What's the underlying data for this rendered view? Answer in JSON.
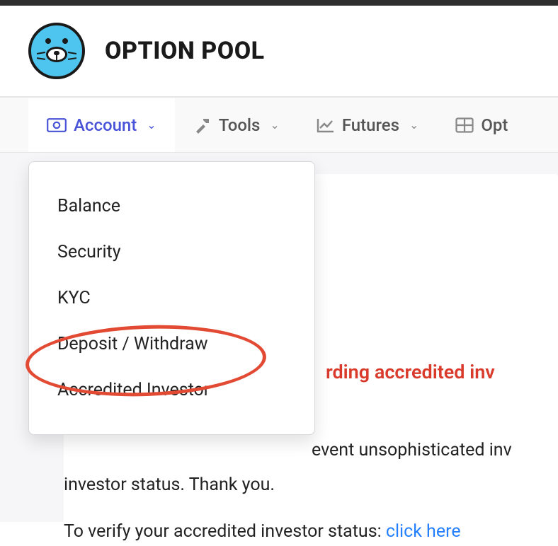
{
  "brand": {
    "name": "OPTION POOL"
  },
  "nav": {
    "items": [
      {
        "label": "Account",
        "icon": "cash-icon"
      },
      {
        "label": "Tools",
        "icon": "hammer-icon"
      },
      {
        "label": "Futures",
        "icon": "chart-icon"
      },
      {
        "label": "Opt",
        "icon": "grid-icon"
      }
    ]
  },
  "dropdown": {
    "items": [
      {
        "label": "Balance"
      },
      {
        "label": "Security"
      },
      {
        "label": "KYC"
      },
      {
        "label": "Deposit / Withdraw"
      },
      {
        "label": "Accredited Investor"
      }
    ]
  },
  "content": {
    "heading_partial": "rding accredited inv",
    "line1_partial": "event unsophisticated inv",
    "line2": "investor status. Thank you.",
    "verify_prefix": "To verify your accredited investor status: ",
    "verify_link": "click here"
  }
}
